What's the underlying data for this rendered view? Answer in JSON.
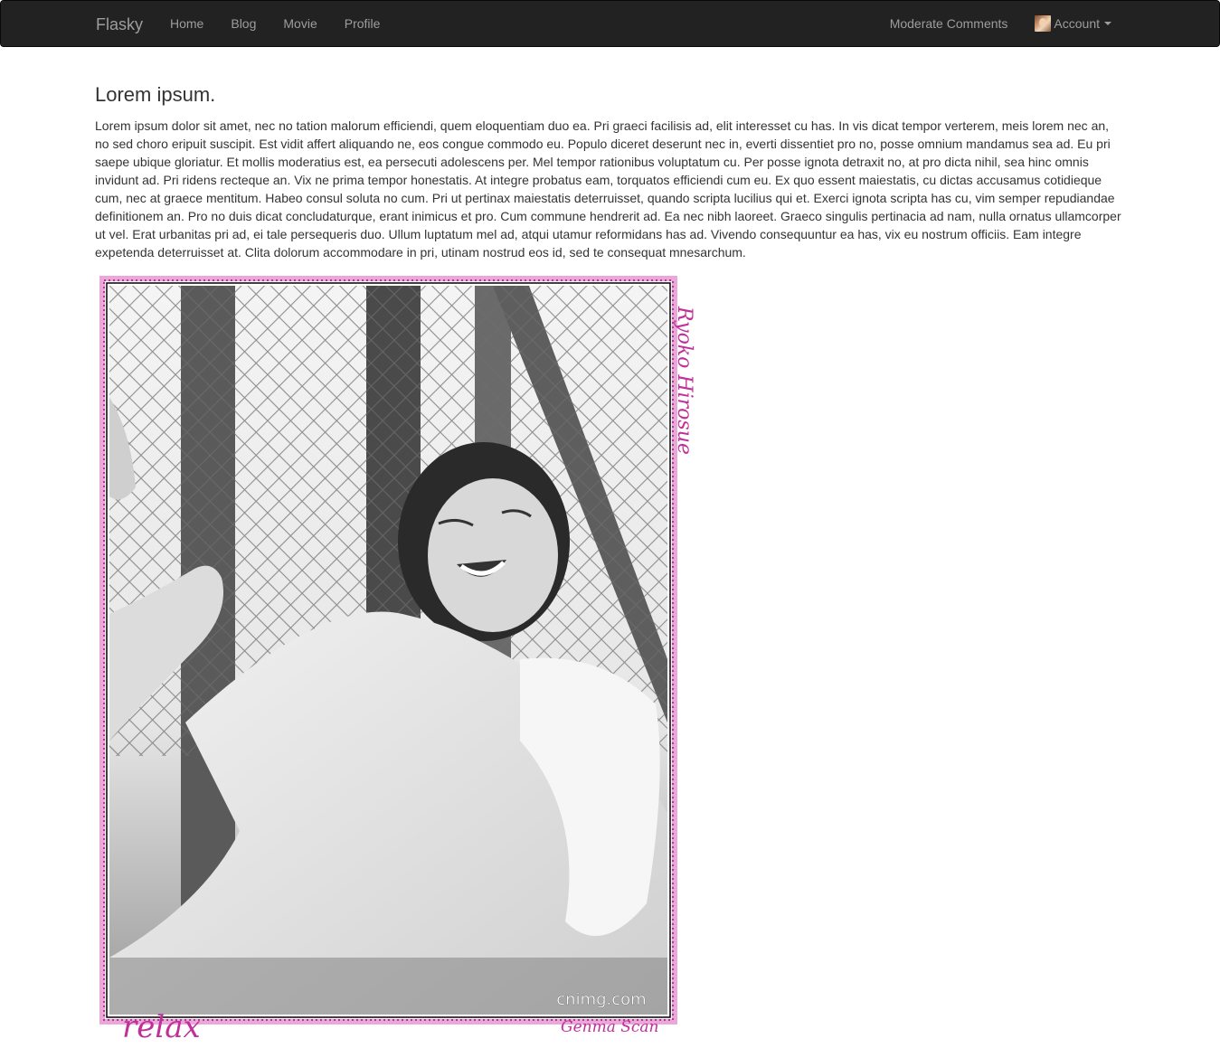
{
  "navbar": {
    "brand": "Flasky",
    "left_links": [
      "Home",
      "Blog",
      "Movie",
      "Profile"
    ],
    "moderate_label": "Moderate Comments",
    "account_label": "Account"
  },
  "article": {
    "title": "Lorem ipsum.",
    "body": "Lorem ipsum dolor sit amet, nec no tation malorum efficiendi, quem eloquentiam duo ea. Pri graeci facilisis ad, elit interesset cu has. In vis dicat tempor verterem, meis lorem nec an, no sed choro eripuit suscipit. Est vidit affert aliquando ne, eos congue commodo eu. Populo diceret deserunt nec in, everti dissentiet pro no, posse omnium mandamus sea ad. Eu pri saepe ubique gloriatur. Et mollis moderatius est, ea persecuti adolescens per. Mel tempor rationibus voluptatum cu. Per posse ignota detraxit no, at pro dicta nihil, sea hinc omnis invidunt ad. Pri ridens recteque an. Vix ne prima tempor honestatis. At integre probatus eam, torquatos efficiendi cum eu. Ex quo essent maiestatis, cu dictas accusamus cotidieque cum, nec at graece mentitum. Habeo consul soluta no cum. Pri ut pertinax maiestatis deterruisset, quando scripta lucilius qui et. Exerci ignota scripta has cu, vim semper repudiandae definitionem an. Pro no duis dicat concludaturque, erant inimicus et pro. Cum commune hendrerit ad. Ea nec nibh laoreet. Graeco singulis pertinacia ad nam, nulla ornatus ullamcorper ut vel. Erat urbanitas pri ad, ei tale persequeris duo. Ullum luptatum mel ad, atqui utamur reformidans has ad. Vivendo consequuntur ea has, vix eu nostrum officiis. Eam integre expetenda deterruisset at. Clita dolorum accommodare in pri, utinam nostrud eos id, sed te consequat mnesarchum."
  },
  "photo": {
    "side_caption": "Ryoko Hirosue",
    "bottom_left_caption": "relax",
    "watermark": "cnimg.com",
    "bottom_right_caption": "Genma Scan",
    "frame_color": "#c0309a"
  }
}
